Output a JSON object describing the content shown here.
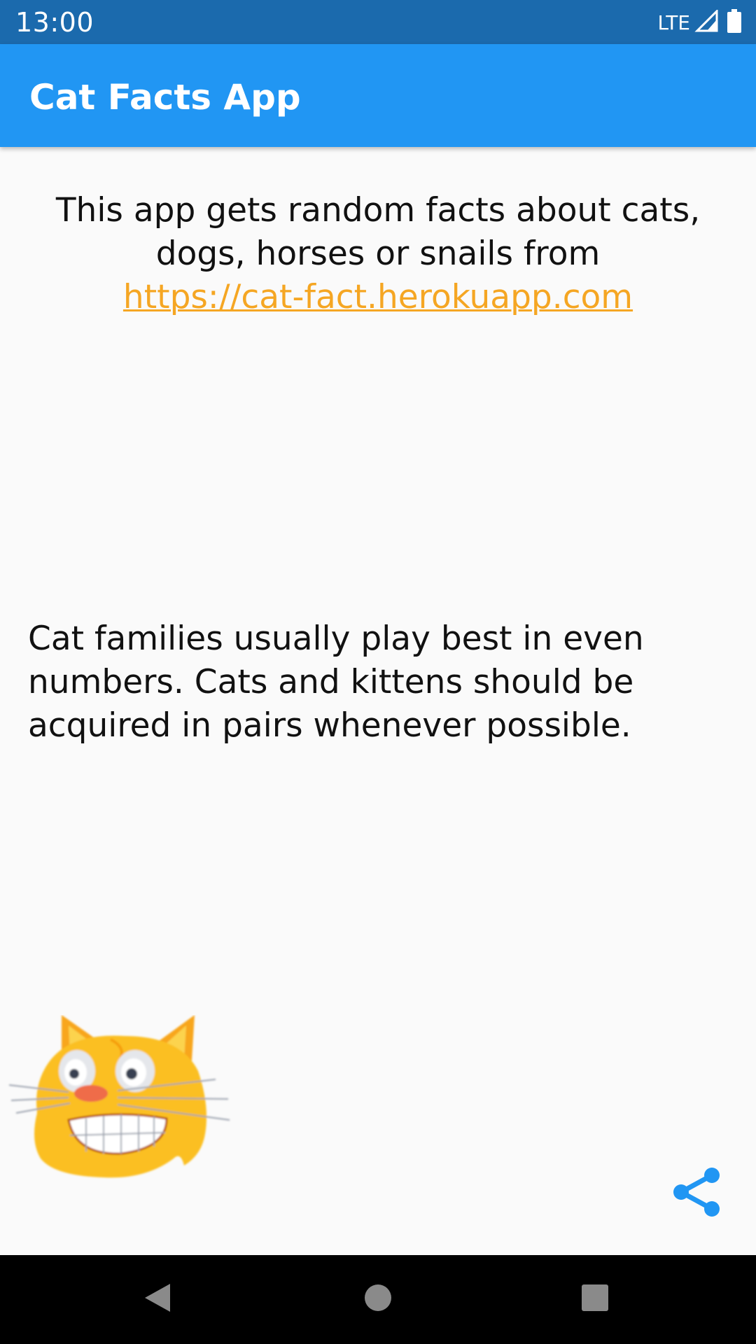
{
  "status_bar": {
    "time": "13:00",
    "network": "LTE"
  },
  "app_bar": {
    "title": "Cat Facts App"
  },
  "intro": {
    "text": "This app gets random facts about cats, dogs, horses or snails from",
    "link_text": "https://cat-fact.herokuapp.com"
  },
  "fact": {
    "text": "Cat families usually play best in even numbers. Cats and kittens should be acquired in pairs whenever possible."
  },
  "icons": {
    "mascot": "grinning-cat-icon",
    "share": "share-icon",
    "back": "back-triangle-icon",
    "home": "home-circle-icon",
    "recents": "recents-square-icon",
    "signal": "signal-icon",
    "battery": "battery-icon"
  },
  "colors": {
    "status_bar": "#1b6aad",
    "app_bar": "#2196f3",
    "link": "#f5a623",
    "share_icon": "#2196f3",
    "background": "#fafafa",
    "nav_bar": "#000000"
  }
}
